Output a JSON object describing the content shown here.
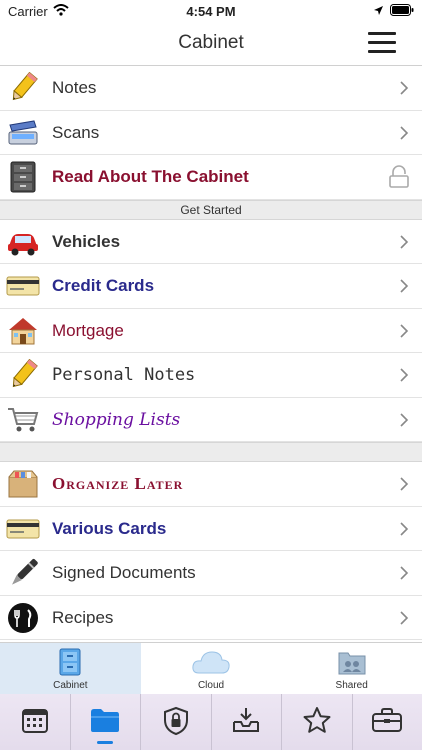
{
  "status_bar": {
    "carrier": "Carrier",
    "time": "4:54 PM"
  },
  "navbar": {
    "title": "Cabinet"
  },
  "top_items": [
    {
      "label": "Notes",
      "icon": "pencil-icon"
    },
    {
      "label": "Scans",
      "icon": "scanner-icon"
    },
    {
      "label": "Read About The Cabinet",
      "icon": "file-cabinet-icon",
      "accessory": "lock-icon"
    }
  ],
  "section_header": "Get Started",
  "get_started_items": [
    {
      "label": "Vehicles",
      "icon": "car-icon"
    },
    {
      "label": "Credit Cards",
      "icon": "credit-card-icon"
    },
    {
      "label": "Mortgage",
      "icon": "house-icon"
    },
    {
      "label": "Personal Notes",
      "icon": "pencil-icon"
    },
    {
      "label": "Shopping Lists",
      "icon": "shopping-cart-icon"
    }
  ],
  "other_items": [
    {
      "label": "Organize Later",
      "icon": "box-icon"
    },
    {
      "label": "Various Cards",
      "icon": "credit-card-icon"
    },
    {
      "label": "Signed Documents",
      "icon": "pen-icon"
    },
    {
      "label": "Recipes",
      "icon": "fork-knife-icon"
    }
  ],
  "tabs": [
    {
      "label": "Cabinet",
      "icon": "cabinet-icon",
      "active": true
    },
    {
      "label": "Cloud",
      "icon": "cloud-icon",
      "active": false
    },
    {
      "label": "Shared",
      "icon": "shared-folder-icon",
      "active": false
    }
  ],
  "bottom_toolbar": [
    {
      "icon": "calendar-icon"
    },
    {
      "icon": "folder-icon",
      "active": true
    },
    {
      "icon": "shield-lock-icon"
    },
    {
      "icon": "inbox-download-icon"
    },
    {
      "icon": "star-icon"
    },
    {
      "icon": "briefcase-icon"
    }
  ],
  "colors": {
    "accent_blue": "#1a7fe0",
    "maroon": "#8a1030",
    "navy": "#2a2a8c",
    "purple": "#6a0fa0",
    "active_tab": "#dde9f5"
  }
}
